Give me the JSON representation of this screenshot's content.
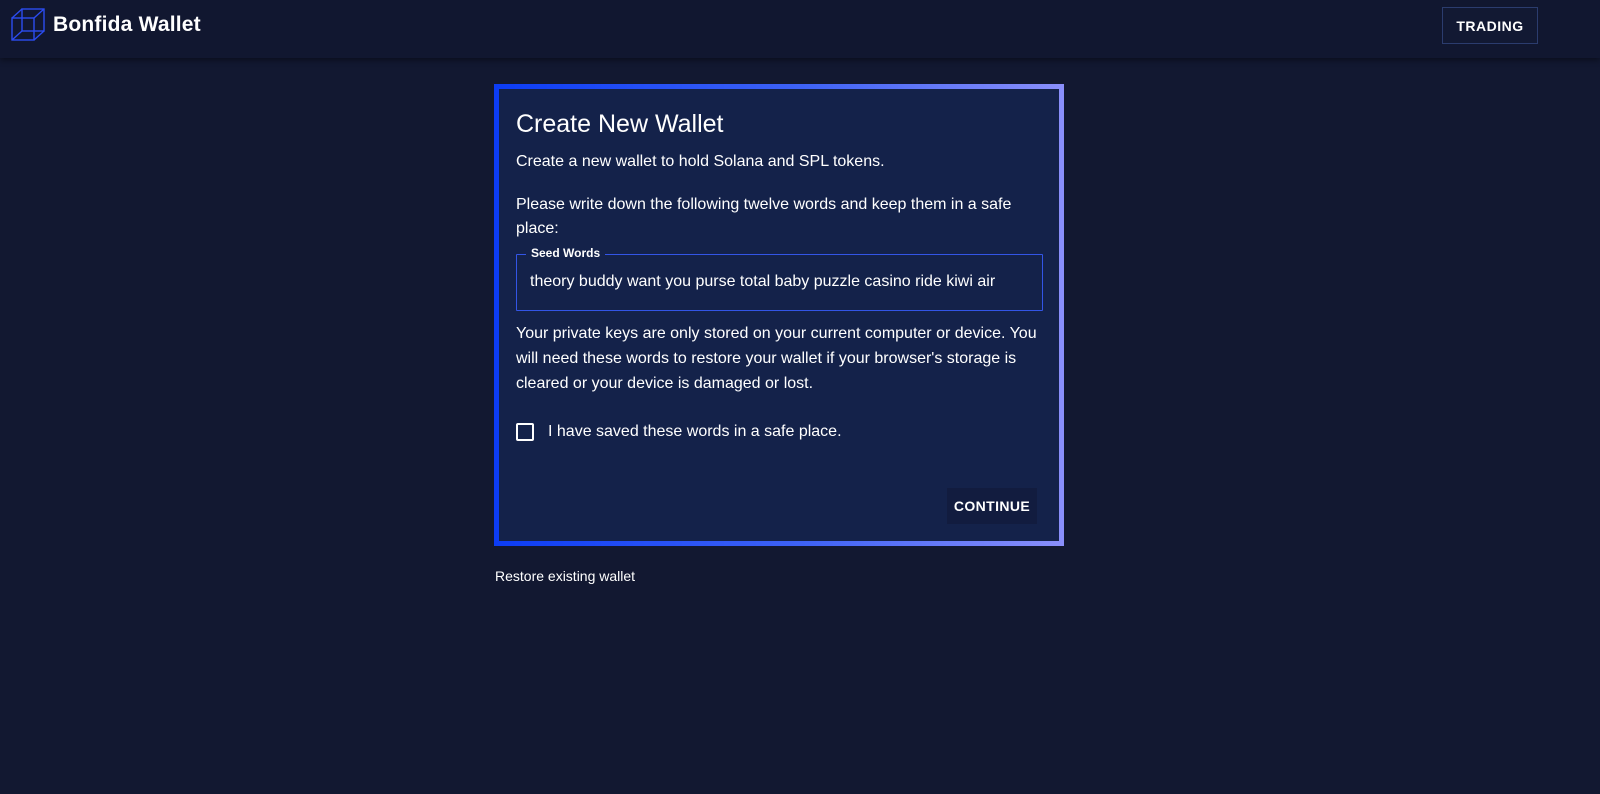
{
  "header": {
    "brand": "Bonfida Wallet",
    "logo_icon": "cube-icon",
    "trading_label": "TRADING"
  },
  "card": {
    "title": "Create New Wallet",
    "subtitle": "Create a new wallet to hold Solana and SPL tokens.",
    "instruction": "Please write down the following twelve words and keep them in a safe place:",
    "seed_field": {
      "label": "Seed Words",
      "value": "theory buddy want you purse total baby puzzle casino ride kiwi air"
    },
    "note": "Your private keys are only stored on your current computer or device. You will need these words to restore your wallet if your browser's storage is cleared or your device is damaged or lost.",
    "checkbox": {
      "label": "I have saved these words in a safe place.",
      "checked": false
    },
    "continue_label": "CONTINUE"
  },
  "footer": {
    "restore_label": "Restore existing wallet"
  },
  "colors": {
    "background": "#121831",
    "card": "#14224a",
    "border_start": "#0c3cf5",
    "border_end": "#8a8ffb",
    "field_border": "#3355e6"
  }
}
